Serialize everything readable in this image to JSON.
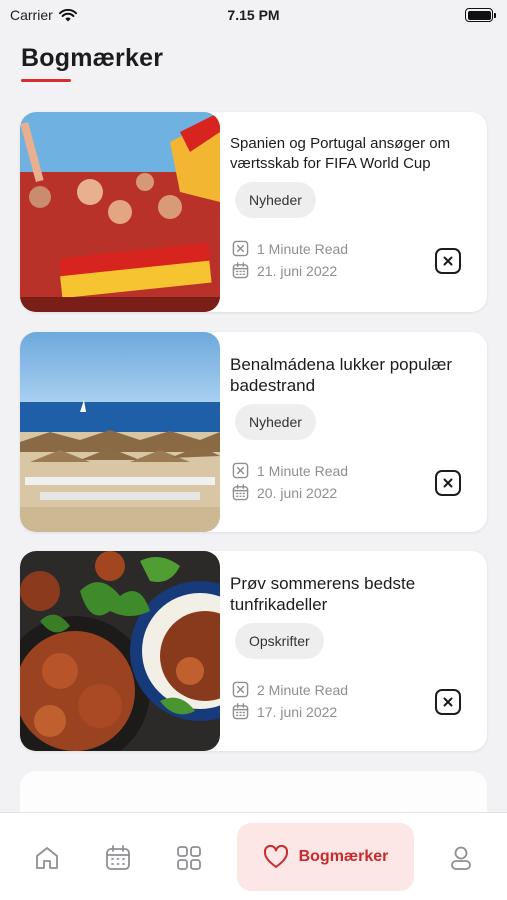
{
  "status": {
    "carrier": "Carrier",
    "time": "7.15 PM"
  },
  "page": {
    "title": "Bogmærker"
  },
  "bookmarks": [
    {
      "title": "Spanien og Portugal ansøger om værtsskab for FIFA World Cup",
      "tag": "Nyheder",
      "read_time": "1 Minute Read",
      "date": "21. juni 2022",
      "image": "football-fans-photo"
    },
    {
      "title": "Benalmádena lukker populær badestrand",
      "tag": "Nyheder",
      "read_time": "1 Minute Read",
      "date": "20. juni 2022",
      "image": "beach-photo"
    },
    {
      "title": "Prøv sommerens bedste tunfrikadeller",
      "tag": "Opskrifter",
      "read_time": "2 Minute Read",
      "date": "17. juni 2022",
      "image": "food-photo"
    }
  ],
  "tabbar": {
    "items": [
      {
        "icon": "home-icon"
      },
      {
        "icon": "calendar-icon"
      },
      {
        "icon": "grid-icon"
      },
      {
        "icon": "heart-icon",
        "label": "Bogmærker",
        "active": true
      },
      {
        "icon": "profile-icon"
      }
    ]
  },
  "colors": {
    "accent": "#d92d2d",
    "active_bg": "#fde6e6",
    "background": "#f2f2f4"
  }
}
